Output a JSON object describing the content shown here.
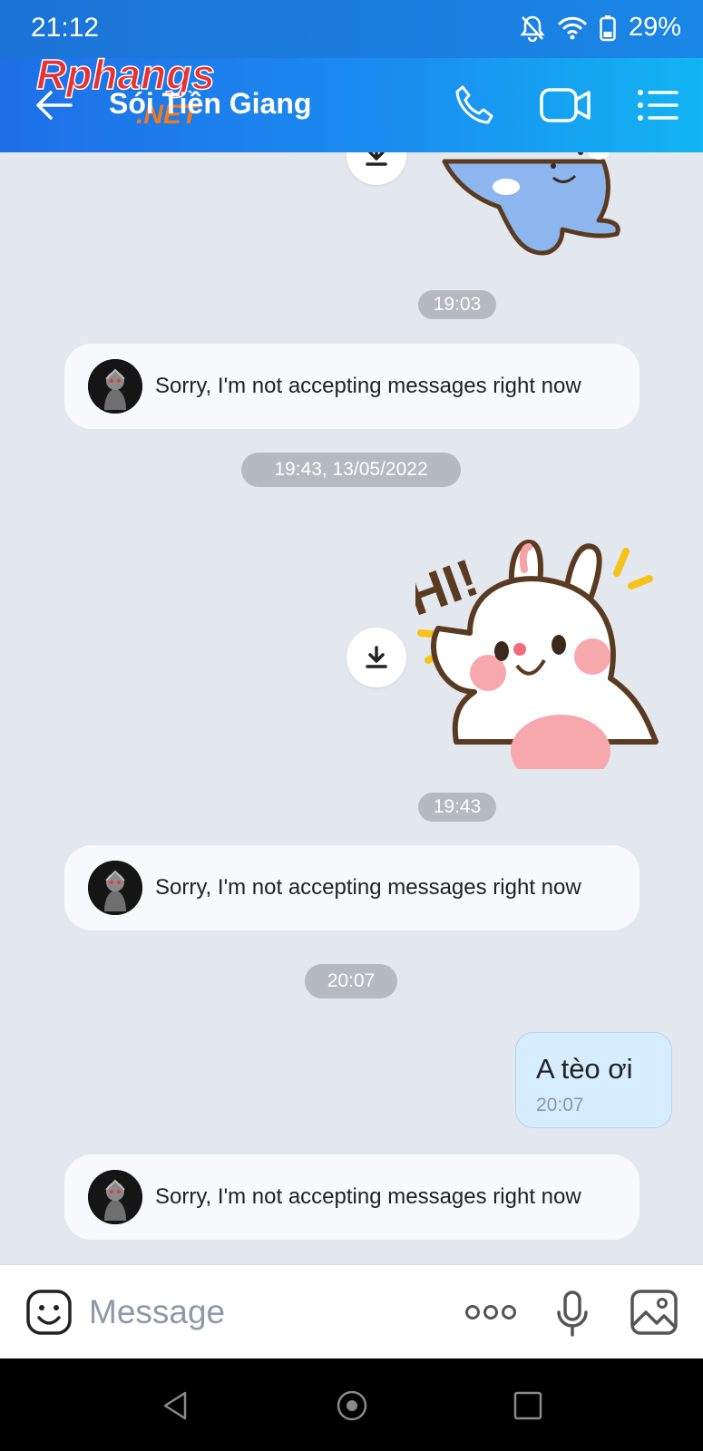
{
  "status_bar": {
    "time": "21:12",
    "battery": "29%"
  },
  "header": {
    "contact_name": "Sói Tiền Giang",
    "watermark_text": "Rphangs.NET"
  },
  "chat": {
    "timestamps": [
      "19:03",
      "19:43, 13/05/2022",
      "19:43",
      "20:07"
    ],
    "auto_reply_text": "Sorry, I'm not accepting messages right now",
    "sent_message": {
      "text": "A tèo ơi",
      "time": "20:07"
    }
  },
  "input_bar": {
    "placeholder": "Message"
  },
  "colors": {
    "header_start": "#1f6fe6",
    "header_end": "#12b4f3",
    "chat_bg": "#e3e7ee",
    "sent_bubble": "#d5edff"
  },
  "icons": [
    "back-arrow-icon",
    "phone-icon",
    "video-call-icon",
    "menu-icon",
    "download-icon",
    "emoji-icon",
    "more-icon",
    "microphone-icon",
    "image-icon",
    "bell-off-icon",
    "wifi-icon",
    "battery-icon"
  ]
}
